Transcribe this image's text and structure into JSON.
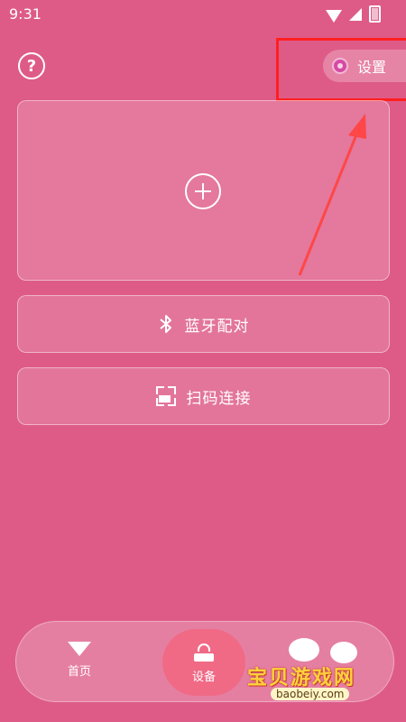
{
  "status_bar": {
    "time": "9:31"
  },
  "help": {
    "label": "?"
  },
  "settings": {
    "label": "设置"
  },
  "actions": {
    "bluetooth_label": "蓝牙配对",
    "scan_label": "扫码连接"
  },
  "bottom_nav": {
    "home_label": "首页",
    "device_label": "设备"
  },
  "watermark": {
    "line1": "宝贝游戏网",
    "line2": "baobeiy.com"
  },
  "colors": {
    "background": "#de5b88",
    "highlight": "#ff1f1f",
    "active_tab": "#f06a86"
  }
}
